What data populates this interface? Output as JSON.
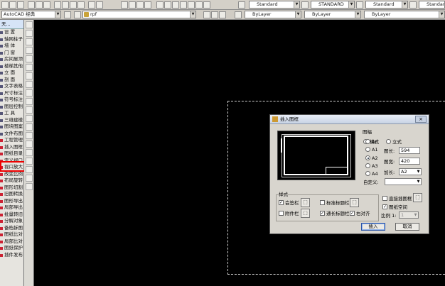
{
  "toolbar": {
    "workspace": "AutoCAD 经典",
    "search_text": "rpf",
    "text_style": "Standard",
    "dim_style": "STANDARD",
    "table_style": "Standard",
    "multileader_style": "Standard",
    "color": "ByLayer"
  },
  "left_menu": {
    "header": "天...",
    "items": [
      "设  置",
      "轴网柱子",
      "墙  体",
      "门  窗",
      "房间屋顶",
      "楼梯其他",
      "立  面",
      "剖  面",
      "文字表格",
      "尺寸标注",
      "符号标注",
      "图层控制",
      "工  具",
      "三维建模",
      "图块图案",
      "文件布图",
      "工程管理",
      "插入图框",
      "图纸目录",
      "定义视口",
      "视口放大",
      "改变比例",
      "布局旋转",
      "图形切割",
      "旧图转换",
      "图形导出",
      "局部导出",
      "批量转旧",
      "分解对象",
      "备档拆图",
      "图纸比对",
      "局部比对",
      "图纸保护",
      "插件发布"
    ],
    "selected": "插入图框"
  },
  "dialog": {
    "title": "插入图框",
    "sheet_label": "图幅",
    "orientation": [
      "横式",
      "立式"
    ],
    "orientation_selected": "横式",
    "sizes": [
      "A0",
      "A1",
      "A2",
      "A3",
      "A4"
    ],
    "size_selected": "A2",
    "length_label": "图长:",
    "length_value": "594",
    "width_label": "图宽:",
    "width_value": "420",
    "extend_label": "加长:",
    "extend_value": "A2",
    "custom_label": "自定义:",
    "custom_value": "",
    "style_label": "样式",
    "chk_countersign": "会签栏",
    "chk_std_title": "标准标题栏",
    "chk_direct_insert": "直接插图框",
    "chk_attach": "附件栏",
    "chk_wide_title": "通长标题栏",
    "chk_right_align": "右对齐",
    "chk_paper_space": "图纸空间",
    "scale_label": "比例 1:",
    "scale_value": "1",
    "insert_button": "插入",
    "cancel_button": "取消",
    "close_glyph": "×"
  }
}
